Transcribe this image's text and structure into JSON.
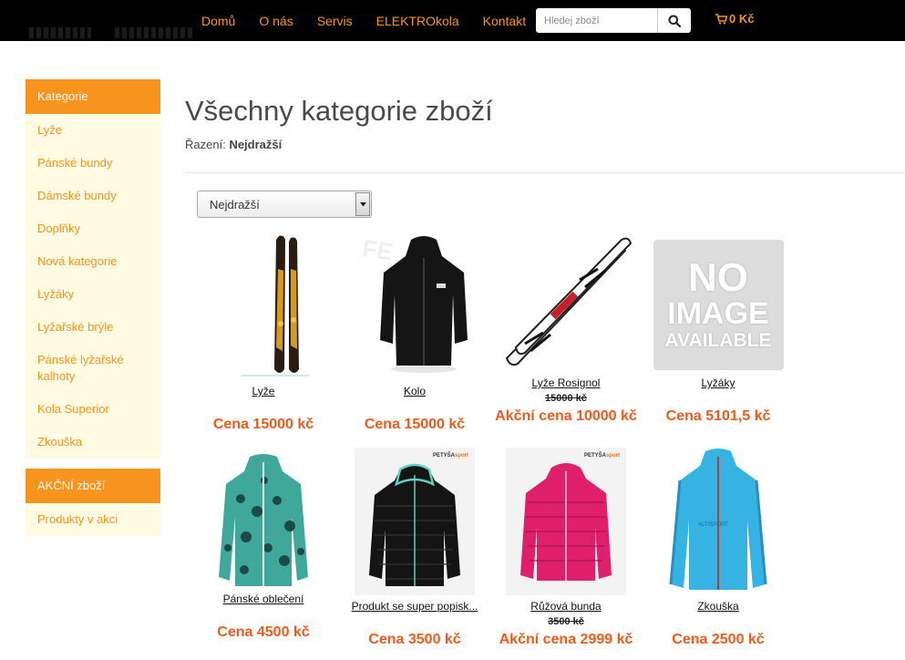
{
  "nav": {
    "items": [
      "Domů",
      "O nás",
      "Servis",
      "ELEKTROkola",
      "Kontakt"
    ]
  },
  "search": {
    "placeholder": "Hledej zboží",
    "value": ""
  },
  "cart": {
    "total": "0 Kč"
  },
  "sidebar": {
    "categories_title": "Kategorie",
    "categories": [
      "Lyže",
      "Pánské bundy",
      "Dámské bundy",
      "Doplňky",
      "Nová kategorie",
      "Lyžáky",
      "Lyžařské brýle",
      "Pánské lyžařské kalhoty",
      "Kola Superior",
      "Zkouška"
    ],
    "sale_title": "AKČNÍ zboží",
    "sale_items": [
      "Produkty v akci"
    ]
  },
  "main": {
    "title": "Všechny kategorie zboží",
    "sort_label": "Řazení:",
    "sort_value": "Nejdražší",
    "select_value": "Nejdražší"
  },
  "products": [
    {
      "name": "Lyže",
      "old_price": "",
      "price": "Cena 15000 kč",
      "image": "skis-gold"
    },
    {
      "name": "Kolo",
      "old_price": "",
      "price": "Cena 15000 kč",
      "image": "black-jacket"
    },
    {
      "name": "Lyže Rosignol",
      "old_price": "15000 kč",
      "price": "Akční cena 10000 kč",
      "image": "skis-white"
    },
    {
      "name": "Lyžáky",
      "old_price": "",
      "price": "Cena 5101,5 kč",
      "image": "no-image",
      "placeholder_lines": [
        "NO",
        "IMAGE",
        "AVAILABLE"
      ]
    },
    {
      "name": "Pánské oblečení",
      "old_price": "",
      "price": "Cena 4500 kč",
      "image": "teal-jacket"
    },
    {
      "name": "Produkt se super popisk...",
      "old_price": "",
      "price": "Cena 3500 kč",
      "image": "black-down-jacket"
    },
    {
      "name": "Růžová bunda",
      "old_price": "3500 kč",
      "price": "Akční cena 2999 kč",
      "image": "pink-down-jacket"
    },
    {
      "name": "Zkouška",
      "old_price": "",
      "price": "Cena 2500 kč",
      "image": "blue-fleece-jacket"
    }
  ]
}
